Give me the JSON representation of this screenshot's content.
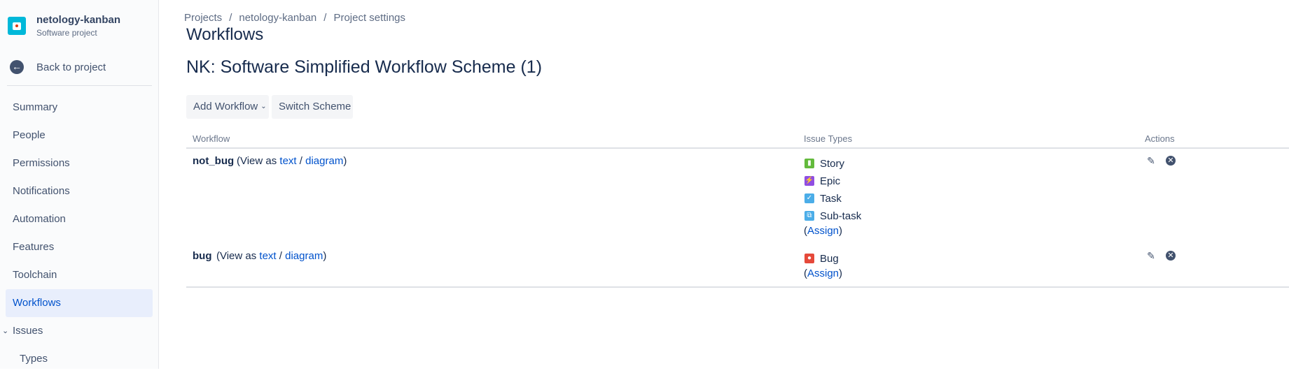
{
  "sidebar": {
    "project_name": "netology-kanban",
    "project_type": "Software project",
    "back_label": "Back to project",
    "items": [
      {
        "label": "Summary"
      },
      {
        "label": "People"
      },
      {
        "label": "Permissions"
      },
      {
        "label": "Notifications"
      },
      {
        "label": "Automation"
      },
      {
        "label": "Features"
      },
      {
        "label": "Toolchain"
      },
      {
        "label": "Workflows",
        "active": true
      },
      {
        "label": "Issues",
        "expanded": true
      },
      {
        "label": "Types"
      }
    ]
  },
  "breadcrumb": [
    "Projects",
    "netology-kanban",
    "Project settings"
  ],
  "page_title": "Workflows",
  "scheme_title": "NK: Software Simplified Workflow Scheme (1)",
  "toolbar": {
    "add_workflow": "Add Workflow",
    "switch_scheme": "Switch Scheme"
  },
  "table": {
    "headers": {
      "workflow": "Workflow",
      "issue_types": "Issue Types",
      "actions": "Actions"
    },
    "view_as_prefix": "(View as",
    "view_text_link": "text",
    "view_slash": "/",
    "view_diagram_link": "diagram",
    "view_suffix": ")",
    "assign_open": "(",
    "assign_label": "Assign",
    "assign_close": ")",
    "rows": [
      {
        "name": "not_bug",
        "issue_types": [
          {
            "label": "Story",
            "icon": "story-icon",
            "color": "#63ba3c"
          },
          {
            "label": "Epic",
            "icon": "epic-icon",
            "color": "#904ee2"
          },
          {
            "label": "Task",
            "icon": "task-icon",
            "color": "#4bade8"
          },
          {
            "label": "Sub-task",
            "icon": "subtask-icon",
            "color": "#4bade8"
          }
        ]
      },
      {
        "name": "bug",
        "issue_types": [
          {
            "label": "Bug",
            "icon": "bug-icon",
            "color": "#e5493a"
          }
        ]
      }
    ]
  },
  "colors": {
    "link": "#0052cc",
    "active_nav_bg": "#e8eefc",
    "text": "#172b4d"
  }
}
